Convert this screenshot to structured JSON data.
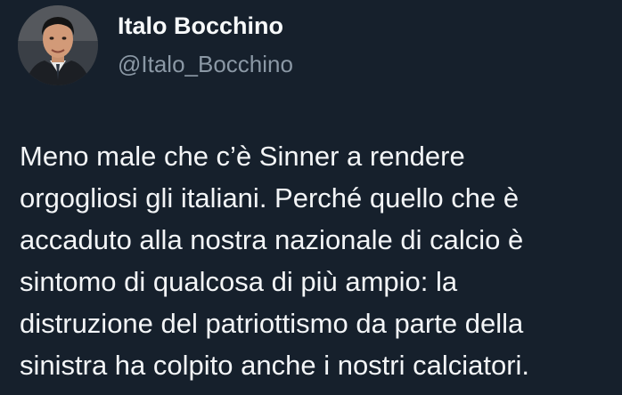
{
  "author": {
    "name": "Italo Bocchino",
    "handle": "@Italo_Bocchino",
    "avatar_icon": "profile-photo-avatar"
  },
  "tweet": {
    "lines": [
      "Meno male che c’è Sinner a rendere",
      "orgogliosi gli italiani. Perché quello che è",
      "accaduto alla nostra nazionale di calcio è",
      "sintomo di qualcosa di più ampio: la",
      "distruzione del patriottismo da parte della",
      "sinistra ha colpito anche i nostri calciatori."
    ]
  },
  "colors": {
    "background": "#16202c",
    "text": "#f3f5f7",
    "handle": "#8b98a5"
  }
}
